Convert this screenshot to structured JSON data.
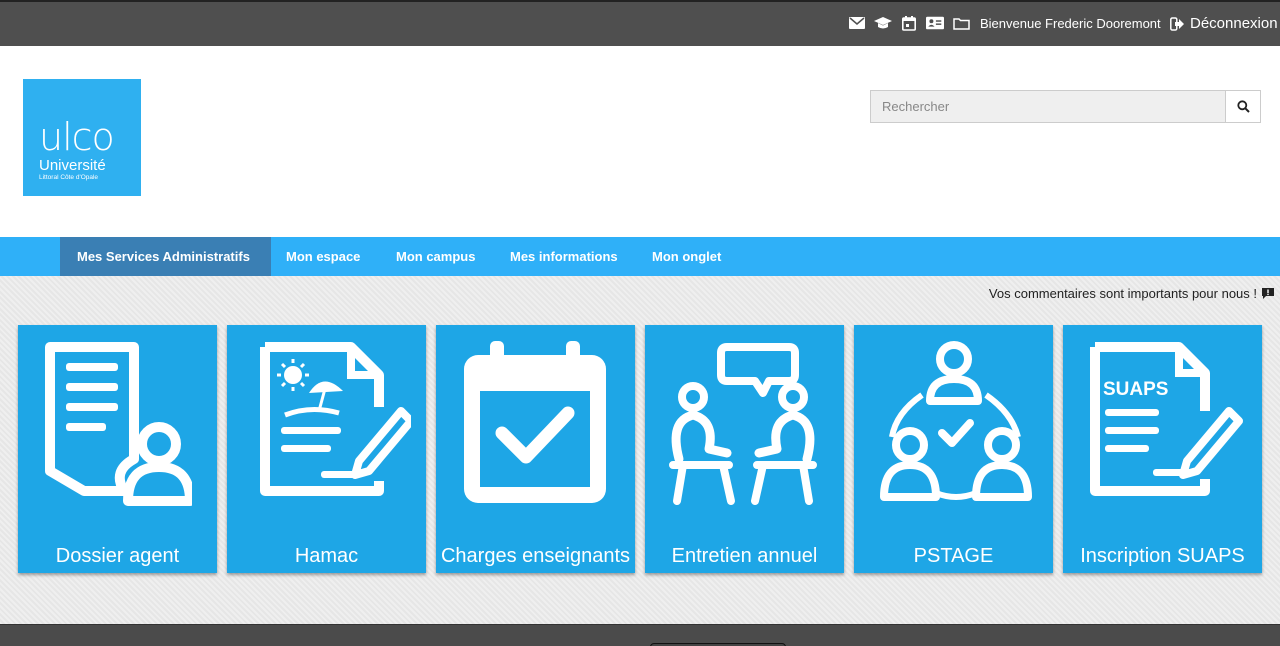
{
  "topbar": {
    "icons": [
      "mail-icon",
      "graduation-cap-icon",
      "calendar-icon",
      "id-card-icon",
      "folder-icon"
    ],
    "welcome": "Bienvenue Frederic Dooremont",
    "logout": "Déconnexion"
  },
  "logo": {
    "brand": "ulco",
    "university": "Université",
    "subtitle": "Littoral Côte d'Opale"
  },
  "search": {
    "placeholder": "Rechercher"
  },
  "nav": {
    "tabs": [
      {
        "label": "Mes Services Administratifs"
      },
      {
        "label": "Mon espace"
      },
      {
        "label": "Mon campus"
      },
      {
        "label": "Mes informations"
      },
      {
        "label": "Mon onglet"
      }
    ]
  },
  "main": {
    "feedback": "Vos commentaires sont importants pour nous !",
    "tiles": [
      {
        "label": "Dossier agent",
        "icon": "document-user-icon"
      },
      {
        "label": "Hamac",
        "icon": "vacation-document-icon"
      },
      {
        "label": "Charges enseignants",
        "icon": "calendar-check-icon"
      },
      {
        "label": "Entretien annuel",
        "icon": "interview-icon"
      },
      {
        "label": "PSTAGE",
        "icon": "network-people-icon"
      },
      {
        "label": "Inscription SUAPS",
        "icon": "suaps-document-icon",
        "badge": "SUAPS"
      }
    ]
  },
  "colors": {
    "tile": "#1ea6e6",
    "nav": "#2fb0f8",
    "nav_active": "#3a7fb4",
    "topbar": "#4f4f4f"
  }
}
